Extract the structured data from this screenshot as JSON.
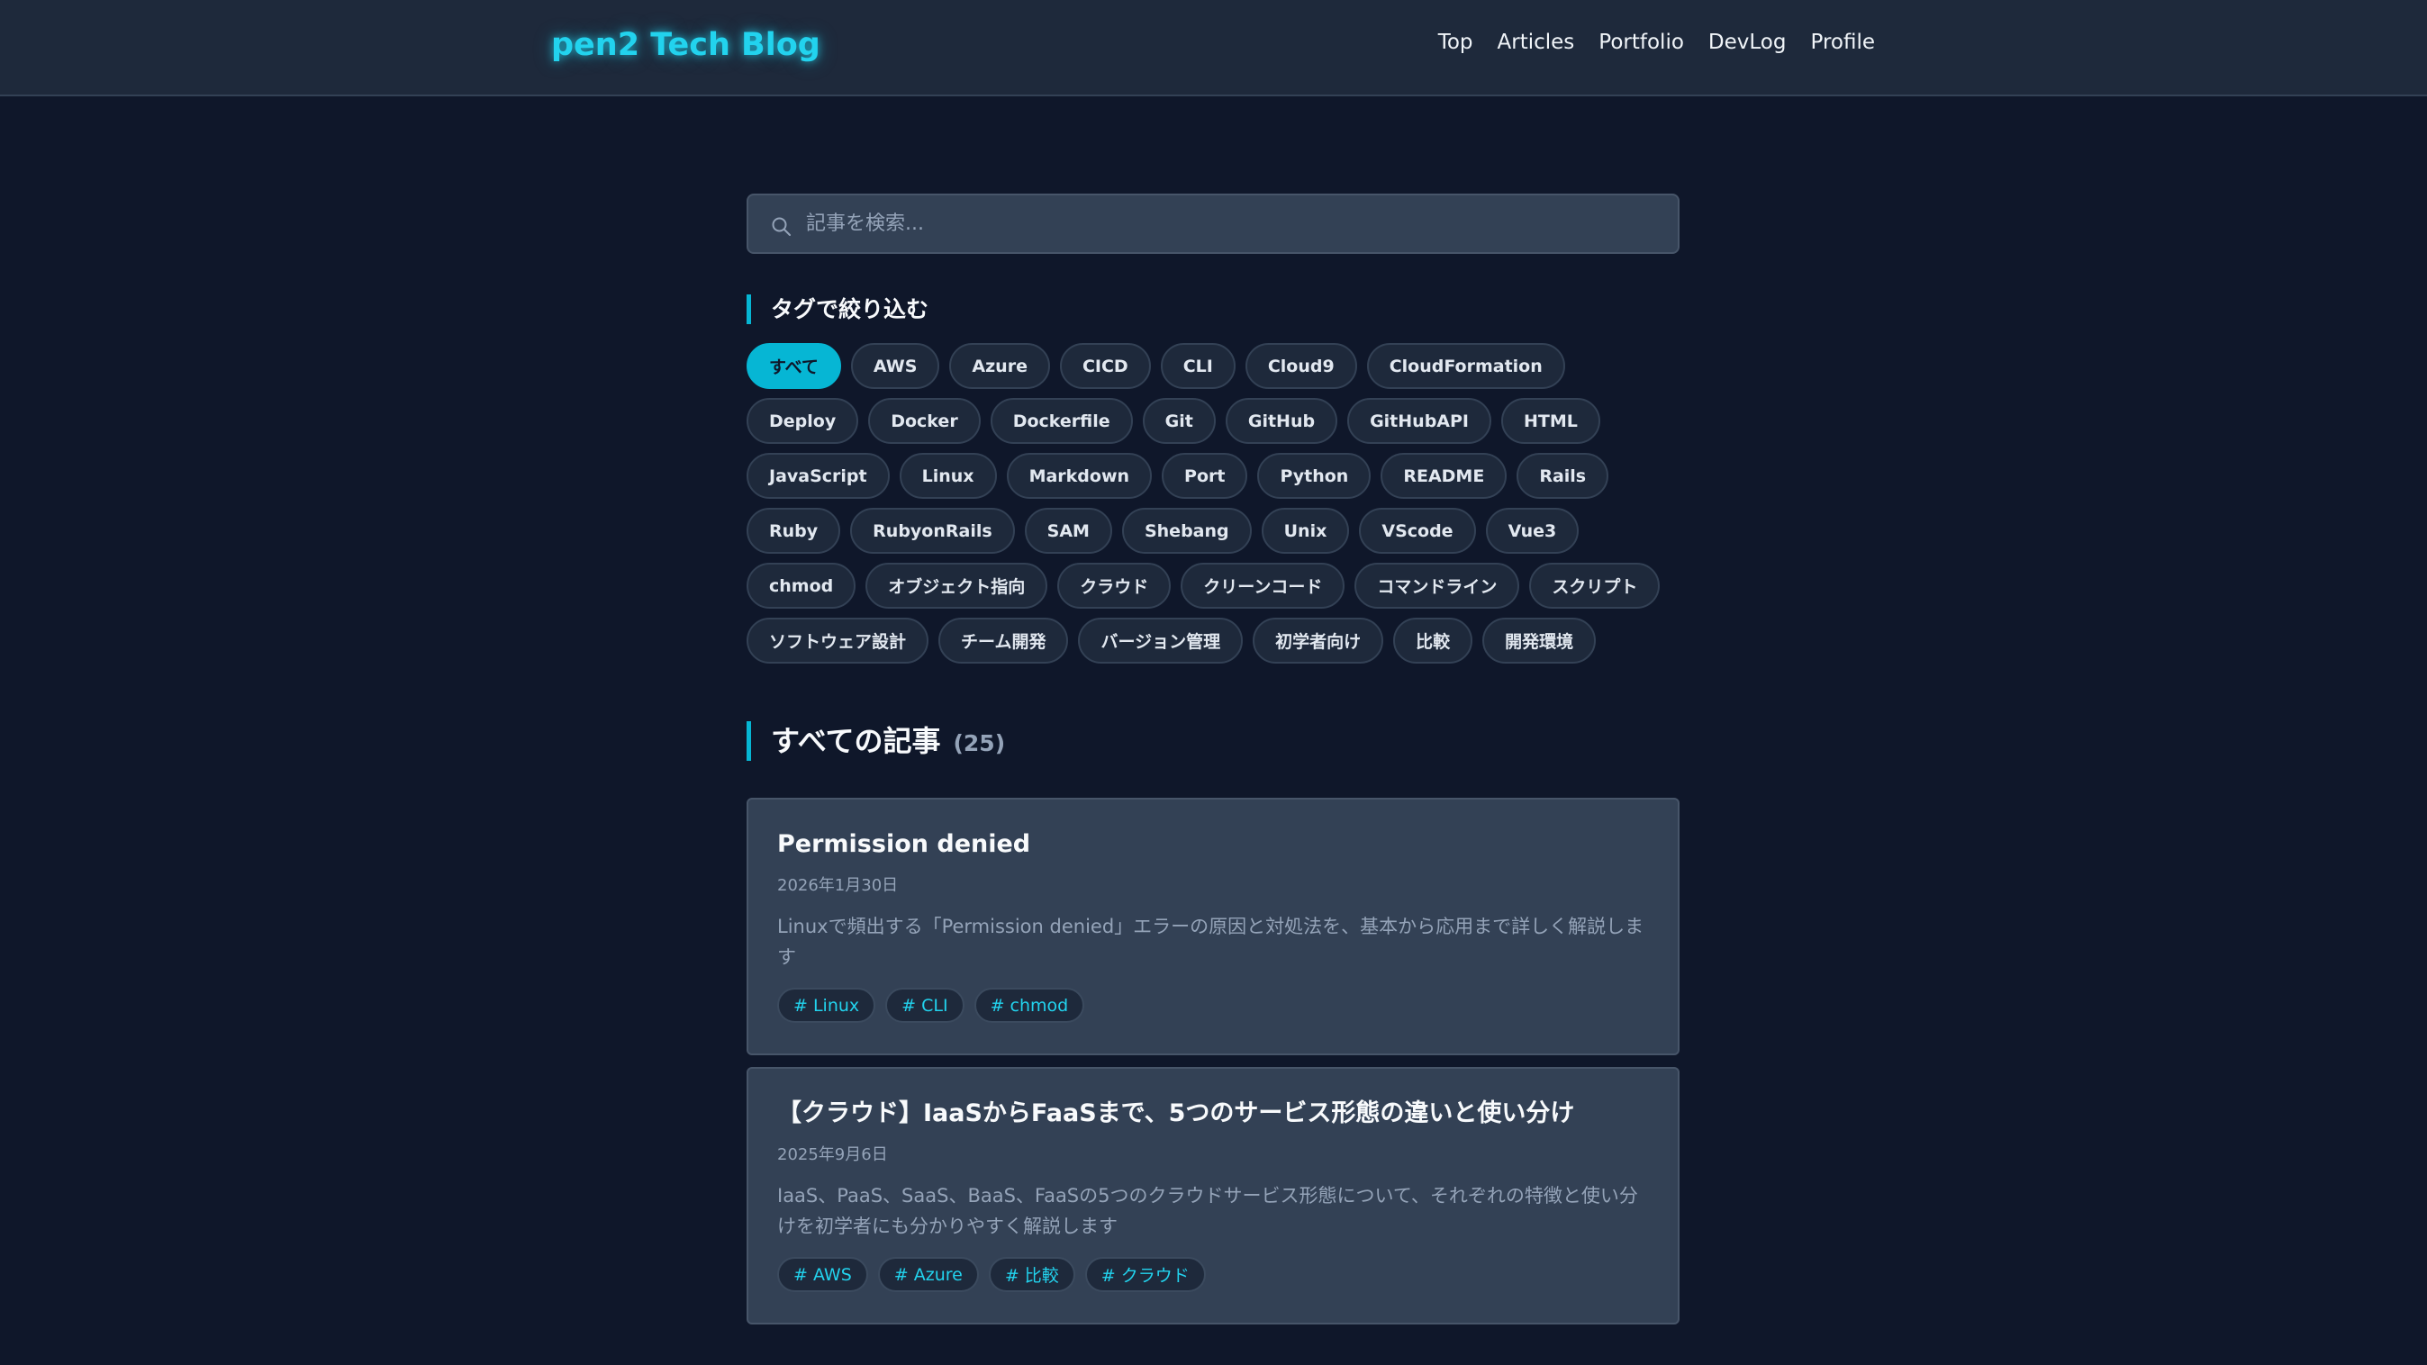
{
  "header": {
    "brand": "pen2 Tech Blog",
    "nav": [
      "Top",
      "Articles",
      "Portfolio",
      "DevLog",
      "Profile"
    ]
  },
  "search": {
    "placeholder": "記事を検索..."
  },
  "tag_filter": {
    "heading": "タグで絞り込む",
    "active": "すべて",
    "tags": [
      "すべて",
      "AWS",
      "Azure",
      "CICD",
      "CLI",
      "Cloud9",
      "CloudFormation",
      "Deploy",
      "Docker",
      "Dockerfile",
      "Git",
      "GitHub",
      "GitHubAPI",
      "HTML",
      "JavaScript",
      "Linux",
      "Markdown",
      "Port",
      "Python",
      "README",
      "Rails",
      "Ruby",
      "RubyonRails",
      "SAM",
      "Shebang",
      "Unix",
      "VScode",
      "Vue3",
      "chmod",
      "オブジェクト指向",
      "クラウド",
      "クリーンコード",
      "コマンドライン",
      "スクリプト",
      "ソフトウェア設計",
      "チーム開発",
      "バージョン管理",
      "初学者向け",
      "比較",
      "開発環境"
    ]
  },
  "articles": {
    "heading": "すべての記事",
    "count": "(25)",
    "items": [
      {
        "title": "Permission denied",
        "date": "2026年1月30日",
        "description": "Linuxで頻出する「Permission denied」エラーの原因と対処法を、基本から応用まで詳しく解説します",
        "tags": [
          "# Linux",
          "# CLI",
          "# chmod"
        ]
      },
      {
        "title": "【クラウド】IaaSからFaaSまで、5つのサービス形態の違いと使い分け",
        "date": "2025年9月6日",
        "description": "IaaS、PaaS、SaaS、BaaS、FaaSの5つのクラウドサービス形態について、それぞれの特徴と使い分けを初学者にも分かりやすく解説します",
        "tags": [
          "# AWS",
          "# Azure",
          "# 比較",
          "# クラウド"
        ]
      }
    ]
  },
  "colors": {
    "background": "#0f172a",
    "header": "#1e293b",
    "card": "#334155",
    "accent": "#06b6d4",
    "brand": "#22d3ee"
  }
}
